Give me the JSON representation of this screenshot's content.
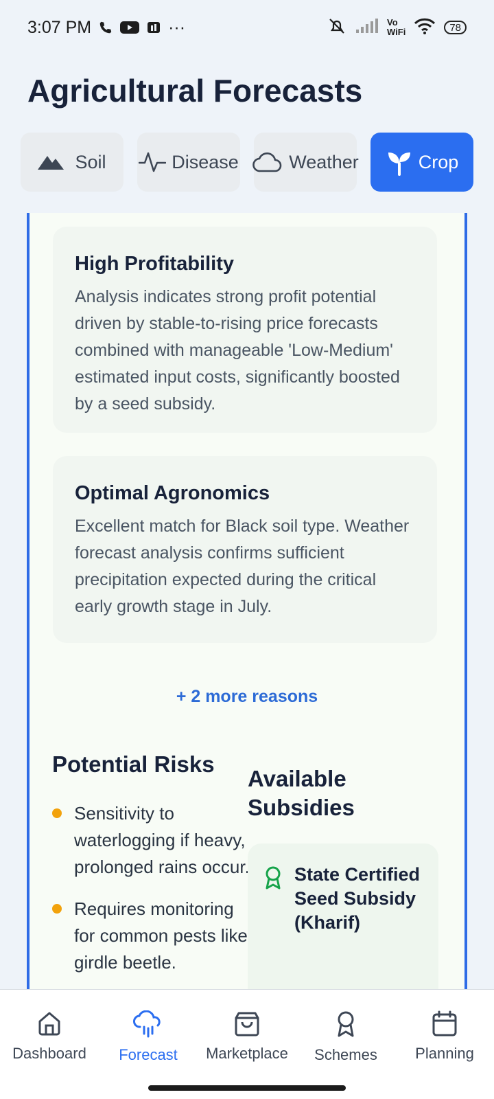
{
  "status": {
    "time": "3:07 PM",
    "dots": "···",
    "vo": "Vo",
    "wifi_label": "WiFi",
    "battery": "78"
  },
  "title": "Agricultural Forecasts",
  "tabs": [
    {
      "label": "Soil",
      "icon": "mountain-icon"
    },
    {
      "label": "Disease",
      "icon": "activity-icon"
    },
    {
      "label": "Weather",
      "icon": "cloud-icon"
    },
    {
      "label": "Crop",
      "icon": "sprout-icon",
      "active": true
    }
  ],
  "reasons": [
    {
      "title": "High Profitability",
      "text": "Analysis indicates strong profit potential driven by stable-to-rising price forecasts combined with manageable 'Low-Medium' estimated input costs, significantly boosted by a seed subsidy."
    },
    {
      "title": "Optimal Agronomics",
      "text": "Excellent match for Black soil type. Weather forecast analysis confirms sufficient precipitation expected during the critical early growth stage in July."
    }
  ],
  "more_reasons": "+ 2 more reasons",
  "risks": {
    "title": "Potential Risks",
    "items": [
      "Sensitivity to waterlogging if heavy, prolonged rains occur.",
      "Requires monitoring for common pests like girdle beetle."
    ]
  },
  "subsidies": {
    "title": "Available Subsidies",
    "items": [
      {
        "name": "State Certified Seed Subsidy (Kharif)"
      }
    ]
  },
  "nav": [
    {
      "label": "Dashboard",
      "icon": "home-icon"
    },
    {
      "label": "Forecast",
      "icon": "cloud-rain-icon",
      "active": true
    },
    {
      "label": "Marketplace",
      "icon": "shopping-bag-icon"
    },
    {
      "label": "Schemes",
      "icon": "award-icon"
    },
    {
      "label": "Planning",
      "icon": "calendar-icon"
    }
  ],
  "colors": {
    "accent": "#2b6ef0",
    "risk_bullet": "#f2a20c",
    "subsidy_icon": "#16a34a"
  }
}
